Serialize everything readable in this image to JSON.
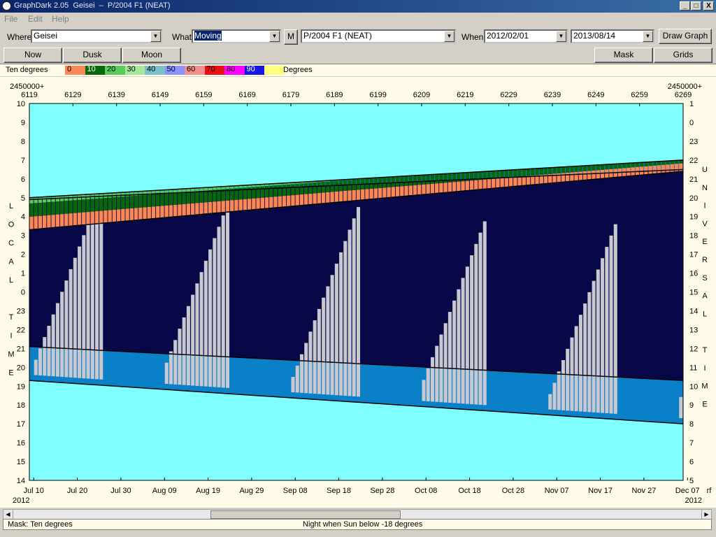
{
  "window": {
    "title": "GraphDark 2.05  Geisei  –  P/2004 F1 (NEAT)",
    "controls": [
      "_",
      "□",
      "X"
    ]
  },
  "menu": [
    "File",
    "Edit",
    "Help"
  ],
  "toolbar": {
    "where_label": "Where",
    "where_value": "Geisei",
    "what_label": "What",
    "what_value": "Moving",
    "m_button": "M",
    "object_value": "P/2004 F1 (NEAT)",
    "when_label": "When",
    "start_date": "2012/02/01",
    "end_date": "2013/08/14",
    "draw_button": "Draw Graph"
  },
  "buttons": {
    "now": "Now",
    "dusk": "Dusk",
    "moon": "Moon",
    "mask": "Mask",
    "grids": "Grids"
  },
  "legend": {
    "label": "Ten degrees",
    "unit": "Degrees",
    "items": [
      {
        "label": "0",
        "color": "#fb8754"
      },
      {
        "label": "10",
        "color": "#07670f"
      },
      {
        "label": "20",
        "color": "#56ce5c"
      },
      {
        "label": "30",
        "color": "#a7e79c"
      },
      {
        "label": "40",
        "color": "#7bc2c8"
      },
      {
        "label": "50",
        "color": "#8b93ff"
      },
      {
        "label": "60",
        "color": "#f29090"
      },
      {
        "label": "70",
        "color": "#e81010"
      },
      {
        "label": "80",
        "color": "#ff00ff"
      },
      {
        "label": "90",
        "color": "#1515e8"
      },
      {
        "label": "",
        "color": "#ffff80"
      }
    ]
  },
  "status": {
    "left": "Mask:  Ten degrees",
    "center": "Night when Sun below -18 degrees"
  },
  "chart_data": {
    "type": "heatmap",
    "jd_prefix": "2450000+",
    "top_ticks": [
      "6119",
      "6129",
      "6139",
      "6149",
      "6159",
      "6169",
      "6179",
      "6189",
      "6199",
      "6209",
      "6219",
      "6229",
      "6239",
      "6249",
      "6259",
      "6269"
    ],
    "bottom_ticks": [
      "Jul 10",
      "Jul 20",
      "Jul 30",
      "Aug 09",
      "Aug 19",
      "Aug 29",
      "Sep 08",
      "Sep 18",
      "Sep 28",
      "Oct 08",
      "Oct 18",
      "Oct 28",
      "Nov 07",
      "Nov 17",
      "Nov 27",
      "Dec 07"
    ],
    "year_left": "2012",
    "year_right": "2012",
    "right_corner_label": "rf",
    "left_axis": {
      "letters": [
        "L",
        "O",
        "C",
        "A",
        "L",
        "",
        "T",
        "I",
        "M",
        "E"
      ],
      "ticks": [
        "10",
        "9",
        "8",
        "7",
        "6",
        "5",
        "4",
        "3",
        "2",
        "1",
        "0",
        "23",
        "22",
        "21",
        "20",
        "19",
        "18",
        "17",
        "16",
        "15",
        "14"
      ]
    },
    "right_axis": {
      "letters": [
        "U",
        "N",
        "I",
        "V",
        "E",
        "R",
        "S",
        "A",
        "L",
        "",
        "T",
        "I",
        "M",
        "E"
      ],
      "ticks": [
        "1",
        "0",
        "23",
        "22",
        "21",
        "20",
        "19",
        "18",
        "17",
        "16",
        "15",
        "14",
        "13",
        "12",
        "11",
        "10",
        "9",
        "8",
        "7",
        "6",
        "5"
      ]
    },
    "dates_jd": [
      6119,
      6269
    ],
    "local_time_range": [
      14,
      34
    ],
    "colors": {
      "day": "#80ffff",
      "twilight": "#0a80c8",
      "night": "#080848",
      "moon": "#c8c8d0",
      "bands": [
        "#fb8754",
        "#07670f",
        "#56ce5c",
        "#a7e79c",
        "#7bc2c8",
        "#8b93ff",
        "#f29090",
        "#e81010",
        "#ff00ff",
        "#1515e8"
      ]
    },
    "sunset_local": [
      19.3,
      17.0
    ],
    "dusk_end_local": [
      21.1,
      19.3
    ],
    "dawn_start_local": [
      28.9,
      30.5
    ],
    "sunrise_local": [
      29.0,
      31.0
    ],
    "object_rise_local": [
      27.3,
      30.4
    ],
    "band_step_hours": 0.7
  }
}
